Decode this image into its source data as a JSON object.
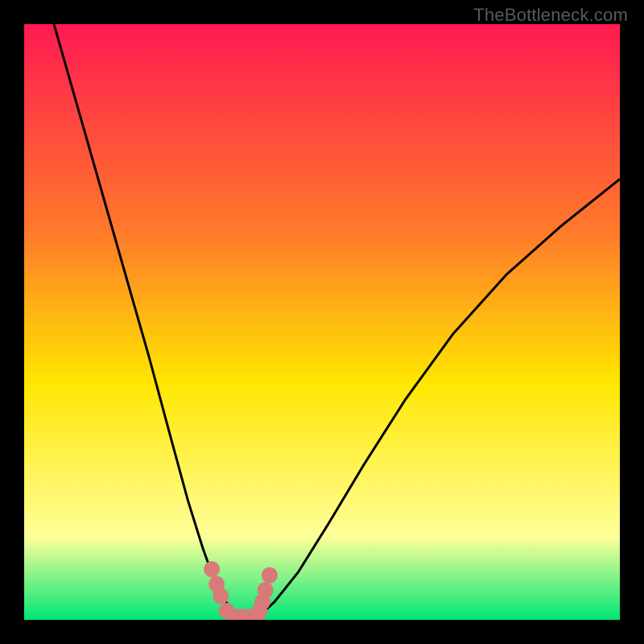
{
  "watermark": "TheBottleneck.com",
  "chart_data": {
    "type": "line",
    "title": "",
    "xlabel": "",
    "ylabel": "",
    "xlim": [
      0,
      1
    ],
    "ylim": [
      0,
      1
    ],
    "background_gradient": {
      "top": "#ff1a52",
      "mid1": "#ff7a2a",
      "mid2": "#ffe600",
      "near_bottom": "#ffff99",
      "bottom": "#00e676"
    },
    "curve_left": {
      "name": "left-branch",
      "x": [
        0.05,
        0.09,
        0.13,
        0.17,
        0.21,
        0.245,
        0.275,
        0.3,
        0.318,
        0.333,
        0.345,
        0.352
      ],
      "y": [
        1.0,
        0.86,
        0.72,
        0.58,
        0.44,
        0.31,
        0.2,
        0.12,
        0.07,
        0.04,
        0.02,
        0.01
      ]
    },
    "curve_right": {
      "name": "right-branch",
      "x": [
        0.398,
        0.42,
        0.46,
        0.51,
        0.57,
        0.64,
        0.72,
        0.81,
        0.9,
        1.0
      ],
      "y": [
        0.01,
        0.03,
        0.08,
        0.16,
        0.26,
        0.37,
        0.48,
        0.58,
        0.66,
        0.74
      ]
    },
    "markers": {
      "name": "valley-points",
      "color": "#d97a7a",
      "points": [
        {
          "x": 0.315,
          "y": 0.085
        },
        {
          "x": 0.323,
          "y": 0.06
        },
        {
          "x": 0.33,
          "y": 0.04
        },
        {
          "x": 0.34,
          "y": 0.015
        },
        {
          "x": 0.352,
          "y": 0.005
        },
        {
          "x": 0.365,
          "y": 0.005
        },
        {
          "x": 0.378,
          "y": 0.005
        },
        {
          "x": 0.39,
          "y": 0.005
        },
        {
          "x": 0.395,
          "y": 0.015
        },
        {
          "x": 0.4,
          "y": 0.03
        },
        {
          "x": 0.405,
          "y": 0.05
        },
        {
          "x": 0.412,
          "y": 0.075
        }
      ]
    }
  }
}
